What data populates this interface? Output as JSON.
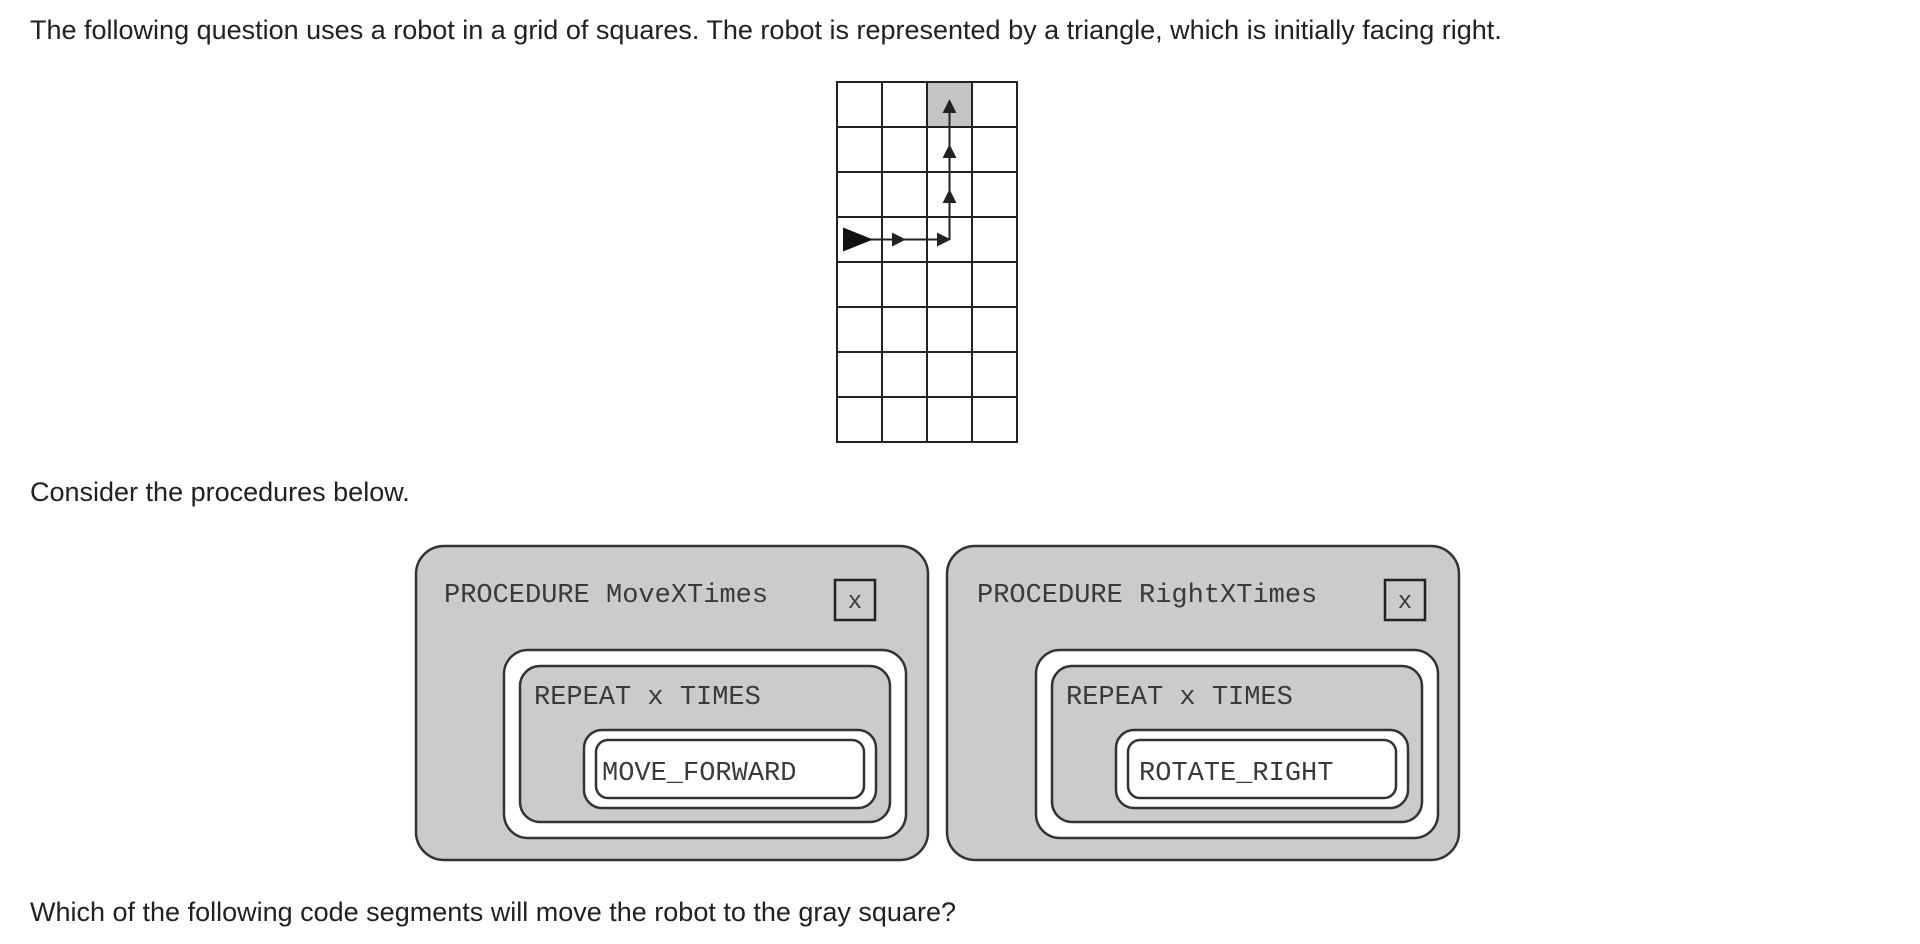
{
  "paragraphs": {
    "intro": "The following question uses a robot in a grid of squares. The robot is represented by a triangle, which is initially facing right.",
    "consider": "Consider the procedures below.",
    "question": "Which of the following code segments will move the robot to the gray square?"
  },
  "grid": {
    "rows": 8,
    "cols": 4,
    "robot": {
      "row": 3,
      "col": 0,
      "facing": "right"
    },
    "gray_square": {
      "row": 0,
      "col": 2
    },
    "path": [
      [
        0,
        3
      ],
      [
        2,
        3
      ],
      [
        2,
        0
      ]
    ],
    "colors": {
      "gray": "#c4c4c4",
      "line": "#222222"
    }
  },
  "procedures": [
    {
      "header": "PROCEDURE MoveXTimes",
      "param": "x",
      "loop": "REPEAT x TIMES",
      "command": "MOVE_FORWARD"
    },
    {
      "header": "PROCEDURE RightXTimes",
      "param": "x",
      "loop": "REPEAT x TIMES",
      "command": "ROTATE_RIGHT"
    }
  ],
  "colors": {
    "block_fill": "#cbcbcb",
    "block_stroke": "#333333"
  }
}
